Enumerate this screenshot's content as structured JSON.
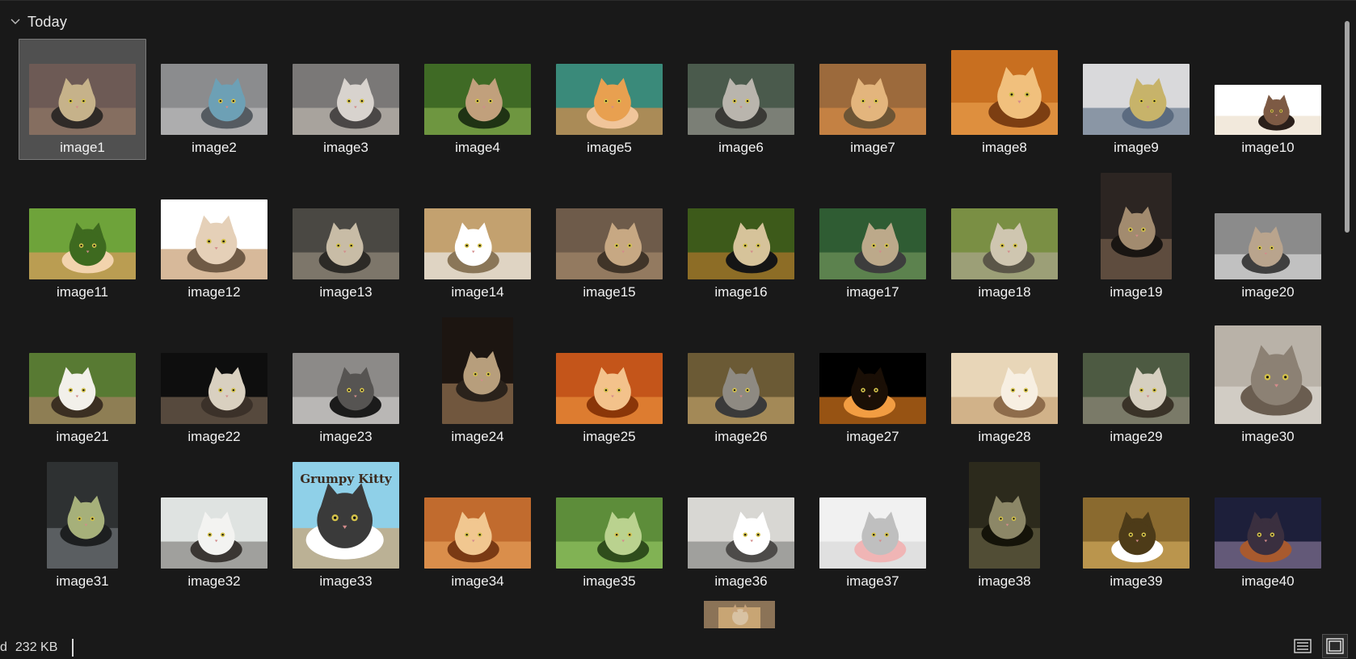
{
  "group": {
    "title": "Today"
  },
  "items": [
    {
      "label": "image1",
      "selected": true
    },
    {
      "label": "image2"
    },
    {
      "label": "image3"
    },
    {
      "label": "image4"
    },
    {
      "label": "image5"
    },
    {
      "label": "image6"
    },
    {
      "label": "image7"
    },
    {
      "label": "image8"
    },
    {
      "label": "image9"
    },
    {
      "label": "image10"
    },
    {
      "label": "image11"
    },
    {
      "label": "image12"
    },
    {
      "label": "image13"
    },
    {
      "label": "image14"
    },
    {
      "label": "image15"
    },
    {
      "label": "image16"
    },
    {
      "label": "image17"
    },
    {
      "label": "image18"
    },
    {
      "label": "image19"
    },
    {
      "label": "image20"
    },
    {
      "label": "image21"
    },
    {
      "label": "image22"
    },
    {
      "label": "image23"
    },
    {
      "label": "image24"
    },
    {
      "label": "image25"
    },
    {
      "label": "image26"
    },
    {
      "label": "image27"
    },
    {
      "label": "image28"
    },
    {
      "label": "image29"
    },
    {
      "label": "image30"
    },
    {
      "label": "image31"
    },
    {
      "label": "image32"
    },
    {
      "label": "image33",
      "poster_text": "Grumpy Kitty"
    },
    {
      "label": "image34"
    },
    {
      "label": "image35"
    },
    {
      "label": "image36"
    },
    {
      "label": "image37"
    },
    {
      "label": "image38"
    },
    {
      "label": "image39"
    },
    {
      "label": "image40"
    }
  ],
  "status": {
    "prefix": "d",
    "selected_size": "232 KB"
  },
  "view_buttons": [
    {
      "name": "details-view-button",
      "icon": "list-view-icon",
      "active": false
    },
    {
      "name": "large-icons-view-button",
      "icon": "large-icons-view-icon",
      "active": true
    }
  ],
  "colors": {
    "background": "#191919",
    "selected_tile": "#505050",
    "scrollbar_thumb": "#a4a4a4"
  }
}
